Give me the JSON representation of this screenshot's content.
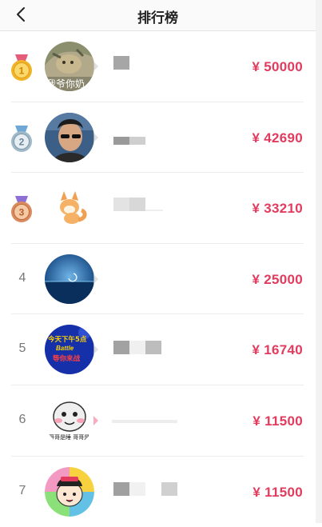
{
  "header": {
    "title": "排行榜",
    "back_icon": "chevron-left-icon"
  },
  "colors": {
    "accent": "#e23b5e",
    "gold": "#f0b429",
    "silver": "#9fb9c9",
    "bronze": "#d98b5f",
    "purple": "#8e6fd6"
  },
  "ranking": [
    {
      "rank": "1",
      "badge": "gold-medal-icon",
      "amount": "¥ 50000",
      "avatar_text": "我爷你奶"
    },
    {
      "rank": "2",
      "badge": "silver-medal-icon",
      "amount": "¥ 42690"
    },
    {
      "rank": "3",
      "badge": "bronze-medal-icon",
      "amount": "¥ 33210"
    },
    {
      "rank": "4",
      "amount": "¥ 25000"
    },
    {
      "rank": "5",
      "amount": "¥ 16740",
      "avatar_text_line1": "今天下午5点",
      "avatar_text_line2": "Battle",
      "avatar_text_line3": "等你来战"
    },
    {
      "rank": "6",
      "amount": "¥ 11500",
      "avatar_text": "哥哥是睡 哥哥是"
    },
    {
      "rank": "7",
      "amount": "¥ 11500"
    }
  ]
}
